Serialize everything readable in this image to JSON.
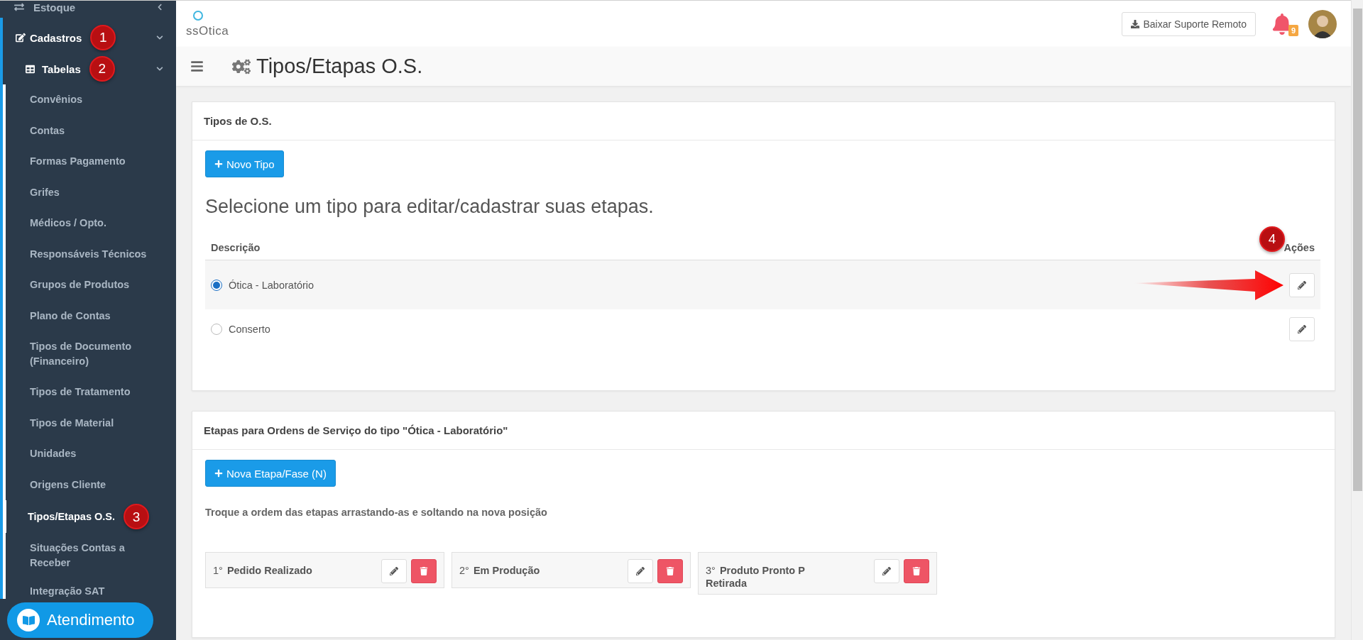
{
  "sidebar": {
    "items": [
      {
        "label": "Estoque",
        "expanded": false
      },
      {
        "label": "Cadastros",
        "expanded": true,
        "callout": "1",
        "children": [
          {
            "label": "Tabelas",
            "expanded": true,
            "callout": "2",
            "children": [
              {
                "label": "Convênios",
                "selected": false
              },
              {
                "label": "Contas",
                "selected": false
              },
              {
                "label": "Formas Pagamento",
                "selected": false
              },
              {
                "label": "Grifes",
                "selected": false
              },
              {
                "label": "Médicos / Opto.",
                "selected": false
              },
              {
                "label": "Responsáveis Técnicos",
                "selected": false
              },
              {
                "label": "Grupos de Produtos",
                "selected": false
              },
              {
                "label": "Plano de Contas",
                "selected": false
              },
              {
                "label": "Tipos de Documento (Financeiro)",
                "selected": false
              },
              {
                "label": "Tipos de Tratamento",
                "selected": false
              },
              {
                "label": "Tipos de Material",
                "selected": false
              },
              {
                "label": "Unidades",
                "selected": false
              },
              {
                "label": "Origens Cliente",
                "selected": false
              },
              {
                "label": "Tipos/Etapas O.S.",
                "selected": true,
                "callout": "3"
              },
              {
                "label": "Situações Contas a Receber",
                "selected": false
              },
              {
                "label": "Integração SAT",
                "selected": false
              }
            ]
          }
        ]
      }
    ],
    "support_button": "Atendimento"
  },
  "topbar": {
    "logo": "ssOtica",
    "download_button": "Baixar Suporte Remoto",
    "notification_count": "9"
  },
  "page_header": {
    "title": "Tipos/Etapas O.S."
  },
  "types_card": {
    "title": "Tipos de O.S.",
    "new_button": "Novo Tipo",
    "prompt": "Selecione um tipo para editar/cadastrar suas etapas.",
    "columns": [
      "Descrição",
      "Ações"
    ],
    "actions_callout": "4",
    "rows": [
      {
        "label": "Ótica - Laboratório",
        "selected": true
      },
      {
        "label": "Conserto",
        "selected": false
      }
    ]
  },
  "stages_card": {
    "title": "Etapas para Ordens de Serviço do tipo \"Ótica - Laboratório\"",
    "new_button": "Nova Etapa/Fase (N)",
    "hint": "Troque a ordem das etapas arrastando-as e soltando na nova posição",
    "stages": [
      {
        "order": "1°",
        "name": "Pedido Realizado"
      },
      {
        "order": "2°",
        "name": "Em Produção"
      },
      {
        "order": "3°",
        "name": "Produto Pronto P Retirada"
      }
    ]
  }
}
